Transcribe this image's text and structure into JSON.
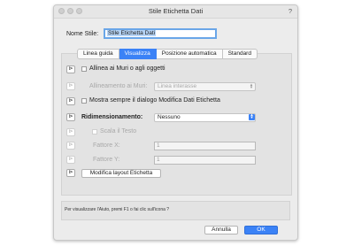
{
  "window": {
    "title": "Stile Etichetta Dati",
    "help": "?"
  },
  "name_field": {
    "label": "Nome Stile:",
    "value": "Stile Etichetta Dati"
  },
  "tabs": [
    {
      "label": "Linea guida",
      "active": false
    },
    {
      "label": "Visualizza",
      "active": true
    },
    {
      "label": "Posizione automatica",
      "active": false
    },
    {
      "label": "Standard",
      "active": false
    }
  ],
  "panel": {
    "align_walls": {
      "label": "Allinea ai Muri o agli oggetti",
      "checked": false
    },
    "wall_alignment": {
      "label": "Allineamento ai Muri:",
      "value": "Linea interasse"
    },
    "always_show_dialog": {
      "label": "Mostra sempre il dialogo Modifica Dati Etichetta",
      "checked": false
    },
    "resize": {
      "label": "Ridimensionamento:",
      "value": "Nessuno"
    },
    "scale_text": {
      "label": "Scala il Testo",
      "checked": false
    },
    "factor_x": {
      "label": "Fattore X:",
      "value": "1"
    },
    "factor_y": {
      "label": "Fattore Y:",
      "value": "1"
    },
    "edit_layout_button": "Modifica layout Etichetta"
  },
  "pin_icon": "pin-icon",
  "info_text": "Per visualizzare l'Aiuto, premi F1 o fai clic sull'icona ?",
  "buttons": {
    "cancel": "Annulla",
    "ok": "OK"
  },
  "colors": {
    "accent": "#3b82f6"
  }
}
